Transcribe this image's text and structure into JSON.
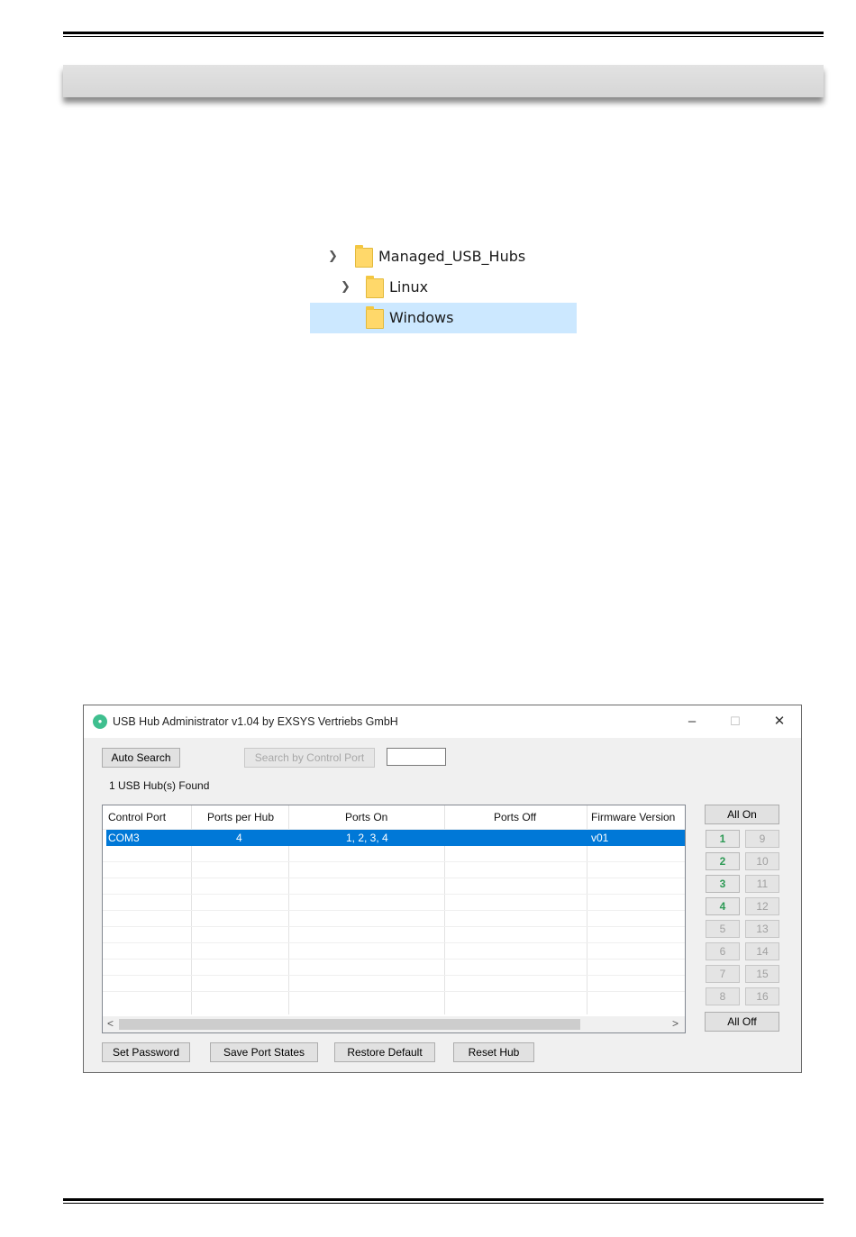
{
  "tree": {
    "items": [
      {
        "label": "Managed_USB_Hubs",
        "expanded": true
      },
      {
        "label": "Linux",
        "expanded": false
      },
      {
        "label": "Windows",
        "selected": true
      }
    ]
  },
  "window": {
    "title": "USB Hub Administrator v1.04 by EXSYS Vertriebs GmbH",
    "controls": {
      "minimize": "–",
      "maximize": "☐",
      "close": "✕"
    },
    "auto_search": "Auto Search",
    "search_by_port": "Search by Control Port",
    "port_value": "",
    "found": "1 USB Hub(s) Found",
    "columns": [
      "Control Port",
      "Ports per Hub",
      "Ports On",
      "Ports Off",
      "Firmware Version"
    ],
    "rows": [
      {
        "control_port": "COM3",
        "ports_per_hub": "4",
        "ports_on": "1, 2, 3, 4",
        "ports_off": "",
        "firmware": "v01"
      }
    ],
    "all_on": "All On",
    "all_off": "All Off",
    "ports_left": [
      "1",
      "2",
      "3",
      "4",
      "5",
      "6",
      "7",
      "8"
    ],
    "ports_right": [
      "9",
      "10",
      "11",
      "12",
      "13",
      "14",
      "15",
      "16"
    ],
    "ports_active": 4,
    "buttons": {
      "set_password": "Set Password",
      "save_states": "Save Port States",
      "restore_default": "Restore Default",
      "reset_hub": "Reset Hub"
    },
    "colors": {
      "selection": "#0078d7",
      "port_on": "#2d9a55",
      "tree_selection": "#cce8ff"
    }
  }
}
